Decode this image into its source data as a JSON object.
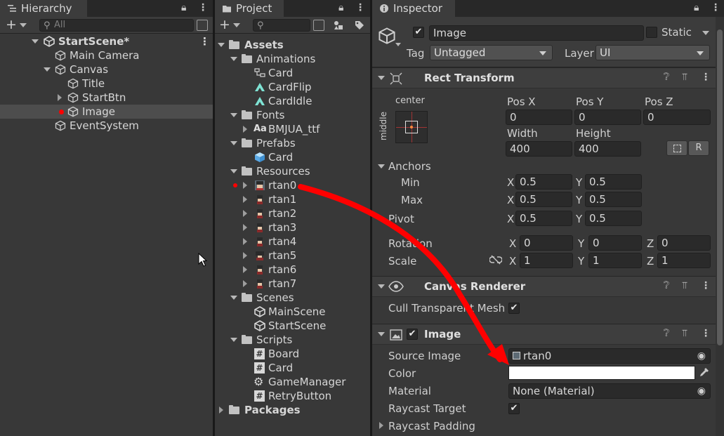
{
  "hierarchy": {
    "tab_label": "Hierarchy",
    "search_placeholder": "All",
    "scene": "StartScene*",
    "items": [
      "Main Camera",
      "Canvas",
      "Title",
      "StartBtn",
      "Image",
      "EventSystem"
    ]
  },
  "project": {
    "tab_label": "Project",
    "tree": {
      "assets": "Assets",
      "animations": "Animations",
      "anim_items": [
        "Card",
        "CardFlip",
        "CardIdle"
      ],
      "fonts": "Fonts",
      "font_items": [
        "BMJUA_ttf"
      ],
      "font_badge": "Aa",
      "prefabs": "Prefabs",
      "prefab_items": [
        "Card"
      ],
      "resources": "Resources",
      "resource_items": [
        "rtan0",
        "rtan1",
        "rtan2",
        "rtan3",
        "rtan4",
        "rtan5",
        "rtan6",
        "rtan7"
      ],
      "scenes": "Scenes",
      "scene_items": [
        "MainScene",
        "StartScene"
      ],
      "scripts": "Scripts",
      "script_items": [
        "Board",
        "Card",
        "GameManager",
        "RetryButton"
      ],
      "packages": "Packages"
    }
  },
  "inspector": {
    "tab_label": "Inspector",
    "object_name": "Image",
    "static_label": "Static",
    "tag_label": "Tag",
    "tag_value": "Untagged",
    "layer_label": "Layer",
    "layer_value": "UI",
    "rect_transform": {
      "title": "Rect Transform",
      "anchor_preset_h": "center",
      "anchor_preset_v": "middle",
      "pos_x_label": "Pos X",
      "pos_x": "0",
      "pos_y_label": "Pos Y",
      "pos_y": "0",
      "pos_z_label": "Pos Z",
      "pos_z": "0",
      "width_label": "Width",
      "width": "400",
      "height_label": "Height",
      "height": "400",
      "anchors_label": "Anchors",
      "min_label": "Min",
      "min_x": "0.5",
      "min_y": "0.5",
      "max_label": "Max",
      "max_x": "0.5",
      "max_y": "0.5",
      "pivot_label": "Pivot",
      "pivot_x": "0.5",
      "pivot_y": "0.5",
      "rotation_label": "Rotation",
      "rot_x": "0",
      "rot_y": "0",
      "rot_z": "0",
      "scale_label": "Scale",
      "scale_x": "1",
      "scale_y": "1",
      "scale_z": "1",
      "axis_x": "X",
      "axis_y": "Y",
      "axis_z": "Z",
      "r_button": "R"
    },
    "canvas_renderer": {
      "title": "Canvas Renderer",
      "cull_label": "Cull Transparent Mesh"
    },
    "image": {
      "title": "Image",
      "source_label": "Source Image",
      "source_value": "rtan0",
      "color_label": "Color",
      "material_label": "Material",
      "material_value": "None (Material)",
      "raycast_target_label": "Raycast Target",
      "raycast_padding_label": "Raycast Padding"
    }
  },
  "colors": {
    "annotation_red": "#ff0000",
    "panel_bg": "#383838",
    "selection_bg": "#4d4d4d"
  }
}
